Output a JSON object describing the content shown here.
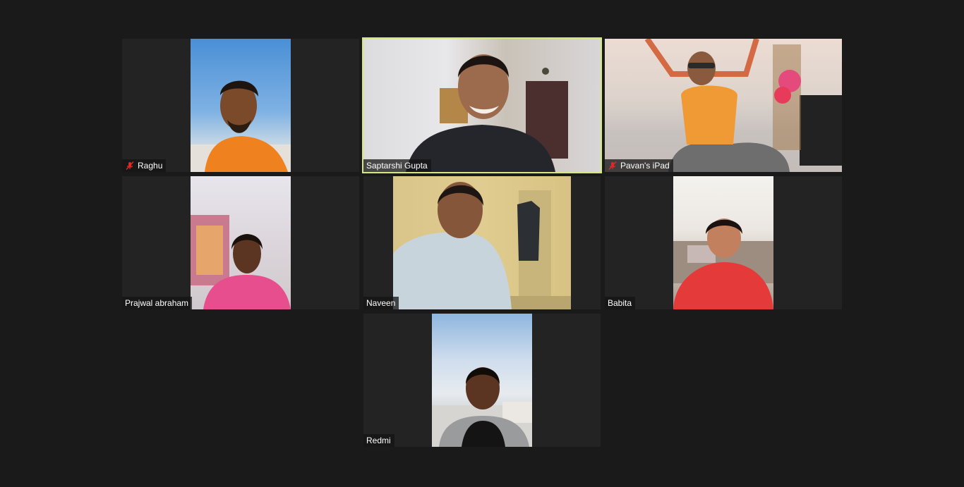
{
  "meeting": {
    "view": "gallery",
    "participants": [
      {
        "id": "raghu",
        "name": "Raghu",
        "muted": true,
        "speaking": false
      },
      {
        "id": "saptarshi",
        "name": "Saptarshi Gupta",
        "muted": false,
        "speaking": true
      },
      {
        "id": "pavan",
        "name": "Pavan's iPad",
        "muted": true,
        "speaking": false
      },
      {
        "id": "prajwal",
        "name": "Prajwal abraham",
        "muted": false,
        "speaking": false
      },
      {
        "id": "naveen",
        "name": "Naveen",
        "muted": false,
        "speaking": false
      },
      {
        "id": "babita",
        "name": "Babita",
        "muted": false,
        "speaking": false
      },
      {
        "id": "redmi",
        "name": "Redmi",
        "muted": false,
        "speaking": false
      }
    ]
  },
  "icons": {
    "mic_muted": "mic-muted-icon"
  },
  "colors": {
    "background": "#1a1a1a",
    "tile": "#232323",
    "active_speaker_border": "#d5e87c",
    "mic_muted": "#e02828"
  }
}
